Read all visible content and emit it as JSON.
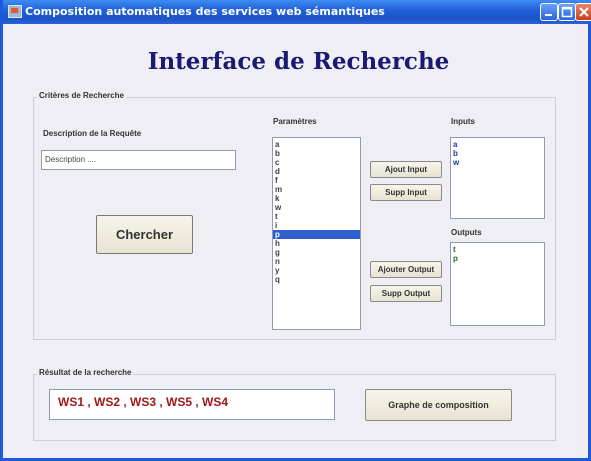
{
  "window": {
    "title": "Composition automatiques des services web sémantiques",
    "controls": [
      "minimize",
      "maximize",
      "close"
    ]
  },
  "heading": "Interface de Recherche",
  "criteria": {
    "legend": "Critères de Recherche",
    "description_label": "Description de la Requête",
    "description_value": "Description ....",
    "search_button": "Chercher",
    "parameters_label": "Paramètres",
    "parameters": [
      "a",
      "b",
      "c",
      "d",
      "f",
      "m",
      "k",
      "w",
      "t",
      "i",
      "p",
      "h",
      "g",
      "n",
      "y",
      "q"
    ],
    "selected_parameter": "p",
    "add_input_button": "Ajout Input",
    "remove_input_button": "Supp Input",
    "add_output_button": "Ajouter Output",
    "remove_output_button": "Supp Output",
    "inputs_label": "Inputs",
    "inputs": [
      "a",
      "b",
      "w"
    ],
    "outputs_label": "Outputs",
    "outputs": [
      "t",
      "p"
    ]
  },
  "result": {
    "legend": "Résultat de la recherche",
    "value": "WS1 , WS2 , WS3 , WS5 , WS4",
    "graph_button": "Graphe de composition"
  }
}
